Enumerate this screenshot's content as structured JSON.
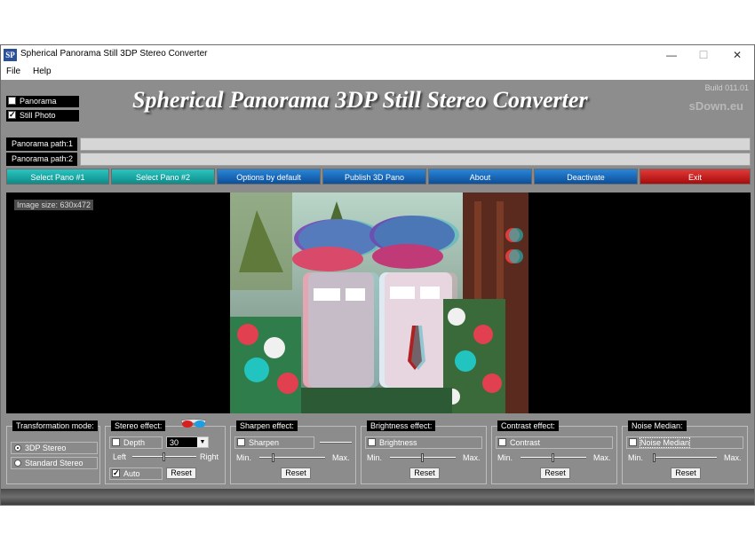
{
  "window": {
    "title": "Spherical Panorama Still 3DP Stereo Converter",
    "app_icon_text": "SP",
    "minimize_glyph": "—",
    "maximize_glyph": "☐",
    "close_glyph": "✕"
  },
  "menu": {
    "items": [
      "File",
      "Help"
    ]
  },
  "header": {
    "modes": [
      {
        "label": "Panorama",
        "checked": false
      },
      {
        "label": "Still Photo",
        "checked": true
      }
    ],
    "title": "Spherical Panorama 3DP Still Stereo Converter",
    "build": "Build 011.01",
    "watermark": "sDown.eu"
  },
  "paths": [
    {
      "label": "Panorama path:1",
      "value": ""
    },
    {
      "label": "Panorama path:2",
      "value": ""
    }
  ],
  "buttons": {
    "select_pano_1": "Select Pano #1",
    "select_pano_2": "Select Pano #2",
    "options_default": "Options by default",
    "publish": "Publish 3D Pano",
    "about": "About",
    "deactivate": "Deactivate",
    "exit": "Exit"
  },
  "viewer": {
    "image_size": "Image size: 630x472"
  },
  "transformation": {
    "title": "Transformation mode:",
    "options": [
      {
        "label": "3DP Stereo",
        "selected": true
      },
      {
        "label": "Standard Stereo",
        "selected": false
      }
    ]
  },
  "stereo": {
    "title": "Stereo effect:",
    "depth_label": "Depth",
    "depth_checked": false,
    "depth_value": "30",
    "left_label": "Left",
    "right_label": "Right",
    "slider_level": 0.5,
    "auto_label": "Auto",
    "auto_checked": true,
    "reset_label": "Reset"
  },
  "sharpen": {
    "title": "Sharpen effect:",
    "check_label": "Sharpen",
    "checked": false,
    "min": "Min.",
    "max": "Max.",
    "slider_level": 0.2,
    "reset_label": "Reset"
  },
  "brightness": {
    "title": "Brightness effect:",
    "check_label": "Brightness",
    "checked": false,
    "min": "Min.",
    "max": "Max.",
    "slider_level": 0.5,
    "reset_label": "Reset"
  },
  "contrast": {
    "title": "Contrast effect:",
    "check_label": "Contrast",
    "checked": false,
    "min": "Min.",
    "max": "Max.",
    "slider_level": 0.5,
    "reset_label": "Reset"
  },
  "noise": {
    "title": "Noise Median:",
    "check_label": "Noise Median",
    "checked": false,
    "min": "Min.",
    "max": "Max.",
    "slider_level": 0.0,
    "reset_label": "Reset"
  },
  "colors": {
    "teal": "#16a6a3",
    "blue": "#0b5fb0",
    "red": "#c01818",
    "background": "#8c8c8c"
  }
}
